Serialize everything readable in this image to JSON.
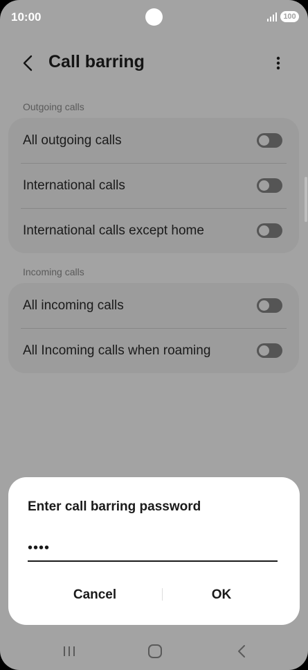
{
  "status_bar": {
    "time": "10:00",
    "battery": "100"
  },
  "header": {
    "title": "Call barring"
  },
  "sections": [
    {
      "label": "Outgoing calls",
      "items": [
        {
          "label": "All outgoing calls",
          "on": false
        },
        {
          "label": "International calls",
          "on": false
        },
        {
          "label": "International calls except home",
          "on": false
        }
      ]
    },
    {
      "label": "Incoming calls",
      "items": [
        {
          "label": "All incoming calls",
          "on": false
        },
        {
          "label": "All Incoming calls when roaming",
          "on": false
        }
      ]
    }
  ],
  "dialog": {
    "title": "Enter call barring password",
    "password_value": "••••",
    "cancel_label": "Cancel",
    "ok_label": "OK"
  },
  "icons": {
    "back": "chevron-left-icon",
    "more": "more-vertical-icon",
    "nav_recents": "recents-icon",
    "nav_home": "home-icon",
    "nav_back": "back-icon"
  }
}
